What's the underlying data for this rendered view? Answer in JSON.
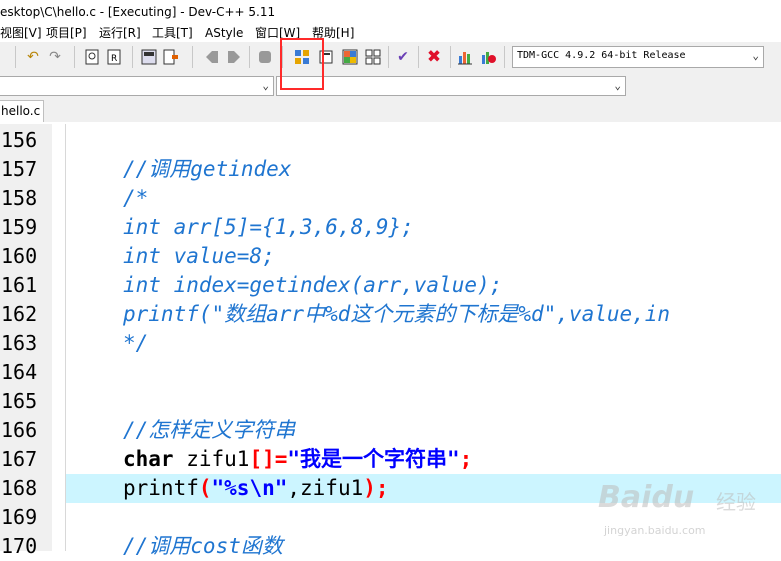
{
  "window": {
    "title": "esktop\\C\\hello.c - [Executing] - Dev-C++ 5.11"
  },
  "menu": [
    {
      "label": "视图[V]"
    },
    {
      "label": "项目[P]"
    },
    {
      "label": "运行[R]"
    },
    {
      "label": "工具[T]"
    },
    {
      "label": "AStyle"
    },
    {
      "label": "窗口[W]"
    },
    {
      "label": "帮助[H]"
    }
  ],
  "toolbar": {
    "compiler_select": "TDM-GCC 4.9.2 64-bit Release",
    "icons": [
      "undo-icon",
      "redo-icon",
      "find-icon",
      "replace-icon",
      "save-all-icon",
      "goto-icon",
      "indent-icon",
      "unindent-icon",
      "toggle-comment-icon",
      "compile-icon",
      "run-icon",
      "compile-run-icon",
      "rebuild-icon",
      "syntax-check-icon",
      "close-icon",
      "chart-icon",
      "profile-icon"
    ]
  },
  "combos": {
    "class_select": "",
    "member_select": ""
  },
  "tab": {
    "label": "hello.c"
  },
  "editor": {
    "lines": [
      {
        "num": "156",
        "text": ""
      },
      {
        "num": "157",
        "text": "//调用getindex"
      },
      {
        "num": "158",
        "text": "/*"
      },
      {
        "num": "159",
        "text": "int arr[5]={1,3,6,8,9};"
      },
      {
        "num": "160",
        "text": "int value=8;"
      },
      {
        "num": "161",
        "text": "int index=getindex(arr,value);"
      },
      {
        "num": "162",
        "text": "printf(\"数组arr中%d这个元素的下标是%d\",value,in"
      },
      {
        "num": "163",
        "text": "*/"
      },
      {
        "num": "164",
        "text": ""
      },
      {
        "num": "165",
        "text": ""
      },
      {
        "num": "166",
        "text": "//怎样定义字符串"
      },
      {
        "num": "167",
        "kw": "char",
        "name": " zifu1",
        "sym1": "[]=",
        "str": "\"我是一个字符串\"",
        "sym2": ";"
      },
      {
        "num": "168",
        "fn": "printf",
        "sym1": "(",
        "str": "\"%s\\n\"",
        "args": ",zifu1",
        "sym2": ");"
      },
      {
        "num": "169",
        "text": ""
      },
      {
        "num": "170",
        "text": "//调用cost函数"
      }
    ]
  },
  "watermark": {
    "logo": "Baidu",
    "cn": "经验",
    "url": "jingyan.baidu.com"
  },
  "colors": {
    "highlight": "#ccf5ff",
    "comment": "#1f75d0",
    "annotation": "#ff2a2a"
  }
}
